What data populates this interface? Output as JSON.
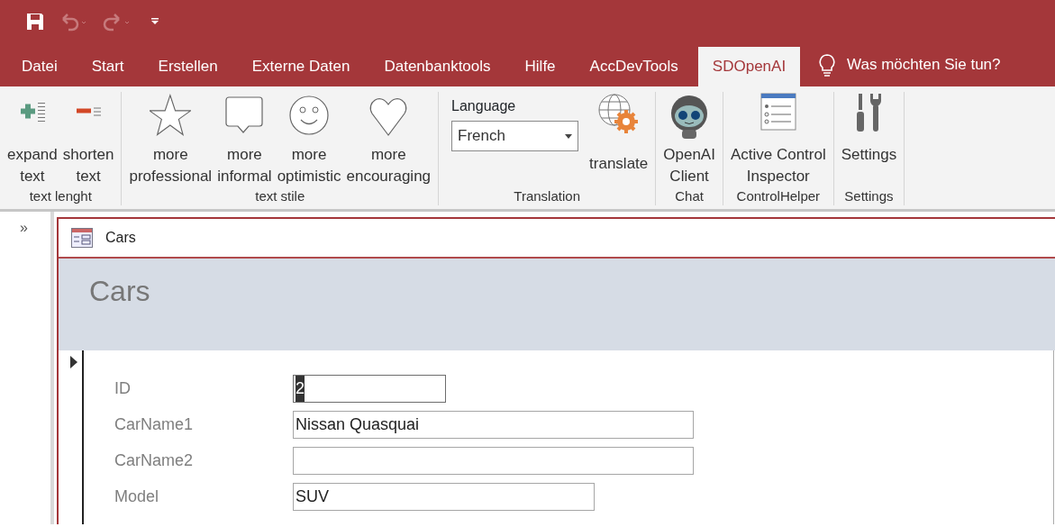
{
  "quick_access": [
    {
      "kind": "save",
      "disabled": false
    },
    {
      "kind": "undo",
      "disabled": true
    },
    {
      "kind": "redo",
      "disabled": true
    },
    {
      "kind": "customize",
      "disabled": false
    }
  ],
  "tabs": [
    {
      "label": "Datei",
      "selected": false
    },
    {
      "label": "Start",
      "selected": false
    },
    {
      "label": "Erstellen",
      "selected": false
    },
    {
      "label": "Externe Daten",
      "selected": false
    },
    {
      "label": "Datenbanktools",
      "selected": false
    },
    {
      "label": "Hilfe",
      "selected": false
    },
    {
      "label": "AccDevTools",
      "selected": false
    },
    {
      "label": "SDOpenAI",
      "selected": true
    }
  ],
  "tell_me": {
    "placeholder": "Was möchten Sie tun?"
  },
  "ribbon_groups": [
    {
      "label": "text lenght",
      "items": [
        {
          "kind": "expand",
          "label": "expand\ntext"
        },
        {
          "kind": "shorten",
          "label": "shorten\ntext"
        }
      ]
    },
    {
      "label": "text stile",
      "items": [
        {
          "kind": "star",
          "label": "more\nprofessional"
        },
        {
          "kind": "speech",
          "label": "more\ninformal"
        },
        {
          "kind": "smiley",
          "label": "more\noptimistic"
        },
        {
          "kind": "heart",
          "label": "more\nencouraging"
        }
      ]
    },
    {
      "label": "Translation",
      "items": [
        {
          "kind": "combo",
          "caption": "Language",
          "value": "French"
        },
        {
          "kind": "globe",
          "label": "translate"
        }
      ]
    },
    {
      "label": "Chat",
      "items": [
        {
          "kind": "robot",
          "label": "OpenAI\nClient"
        }
      ]
    },
    {
      "label": "ControlHelper",
      "items": [
        {
          "kind": "inspector",
          "label": "Active Control\nInspector"
        }
      ]
    },
    {
      "label": "Settings",
      "items": [
        {
          "kind": "tools",
          "label": "Settings"
        }
      ]
    }
  ],
  "nav_pane": {
    "toggle": "»"
  },
  "form": {
    "window_title": "Cars",
    "header_title": "Cars",
    "current_record": true,
    "fields": [
      {
        "label": "ID",
        "value": "2",
        "selected": true
      },
      {
        "label": "CarName1",
        "value": "Nissan Quasquai",
        "selected": false
      },
      {
        "label": "CarName2",
        "selected": false
      },
      {
        "label": "Model",
        "value": "SUV",
        "selected": false
      }
    ]
  }
}
